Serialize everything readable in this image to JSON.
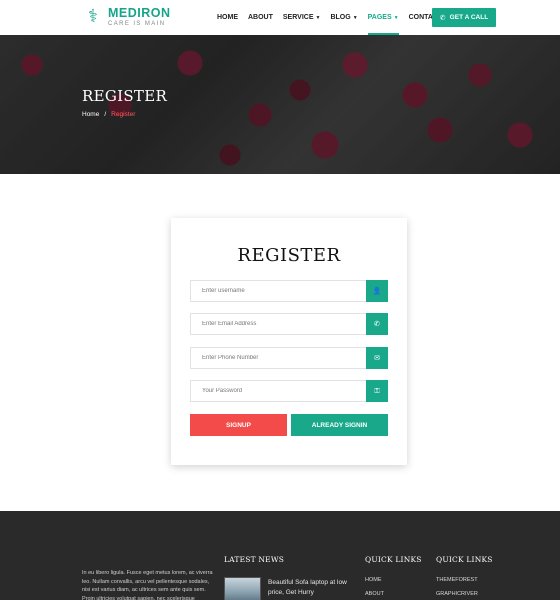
{
  "header": {
    "logo_name": "MEDIRON",
    "logo_tagline": "CARE IS MAIN",
    "nav": [
      {
        "label": "HOME",
        "has_caret": false
      },
      {
        "label": "ABOUT",
        "has_caret": false
      },
      {
        "label": "SERVICE",
        "has_caret": true
      },
      {
        "label": "BLOG",
        "has_caret": true
      },
      {
        "label": "PAGES",
        "has_caret": true,
        "active": true
      },
      {
        "label": "CONTACT",
        "has_caret": false
      }
    ],
    "call_button": "GET A CALL"
  },
  "hero": {
    "title": "REGISTER",
    "breadcrumb_home": "Home",
    "breadcrumb_sep": "/",
    "breadcrumb_current": "Register"
  },
  "form": {
    "title": "REGISTER",
    "username_placeholder": "Enter username",
    "email_placeholder": "Enter Email Address",
    "phone_placeholder": "Enter Phone Number",
    "password_placeholder": "Your Password",
    "signup_label": "SIGNUP",
    "signin_label": "ALREADY SIGNIN"
  },
  "footer": {
    "about_text": "In eu libero ligula. Fusce eget metus lorem, ac viverra leo. Nullam convallis, arcu vel pellentesque sodales, nisi est varius diam, ac ultrices sem ante quis sem. Proin ultricies volutpat sapien, nec scelerisque",
    "latest_news_heading": "LATEST NEWS",
    "news_title": "Beautiful Sofa laptop at low price, Get Hurry",
    "quick_links_heading_1": "QUICK LINKS",
    "quick_links_heading_2": "QUICK LINKS",
    "links_1": [
      "HOME",
      "ABOUT"
    ],
    "links_2": [
      "THEMEFOREST",
      "GRAPHICRIVER"
    ]
  },
  "colors": {
    "brand_green": "#19a98a",
    "signup_red": "#f24b49",
    "footer_bg": "#2a2a2a"
  },
  "icons": {
    "logo": "caduceus-icon",
    "call": "phone-icon",
    "username": "user-icon",
    "email": "phone-handset-icon",
    "phone": "envelope-icon",
    "password": "key-icon"
  }
}
